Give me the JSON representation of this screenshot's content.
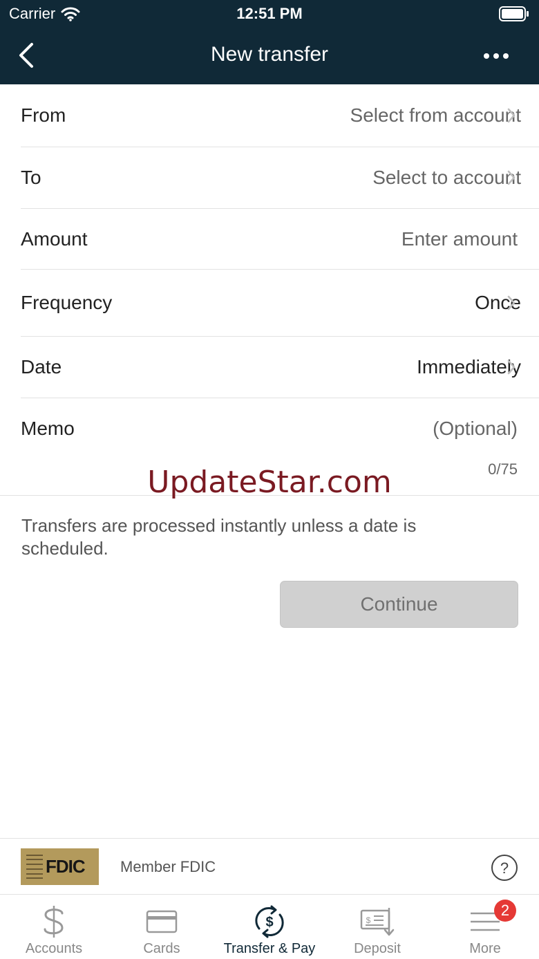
{
  "status_bar": {
    "carrier": "Carrier",
    "time": "12:51 PM"
  },
  "nav": {
    "title": "New transfer"
  },
  "form": {
    "from": {
      "label": "From",
      "value": "Select from account"
    },
    "to": {
      "label": "To",
      "value": "Select to account"
    },
    "amount": {
      "label": "Amount",
      "placeholder": "Enter amount"
    },
    "frequency": {
      "label": "Frequency",
      "value": "Once"
    },
    "date": {
      "label": "Date",
      "value": "Immediately"
    },
    "memo": {
      "label": "Memo",
      "placeholder": "(Optional)",
      "counter": "0/75"
    }
  },
  "watermark": "UpdateStar.com",
  "note": "Transfers are processed instantly unless a date is scheduled.",
  "continue_label": "Continue",
  "footer": {
    "fdic_logo_text": "FDIC",
    "member_text": "Member FDIC"
  },
  "tabs": [
    {
      "label": "Accounts",
      "icon": "dollar-icon"
    },
    {
      "label": "Cards",
      "icon": "card-icon"
    },
    {
      "label": "Transfer & Pay",
      "icon": "transfer-icon",
      "active": true
    },
    {
      "label": "Deposit",
      "icon": "check-deposit-icon"
    },
    {
      "label": "More",
      "icon": "menu-icon",
      "badge": "2"
    }
  ],
  "colors": {
    "header_bg": "#102937",
    "watermark": "#7a1a22",
    "badge": "#e53935",
    "button_disabled": "#d0d0d0"
  }
}
